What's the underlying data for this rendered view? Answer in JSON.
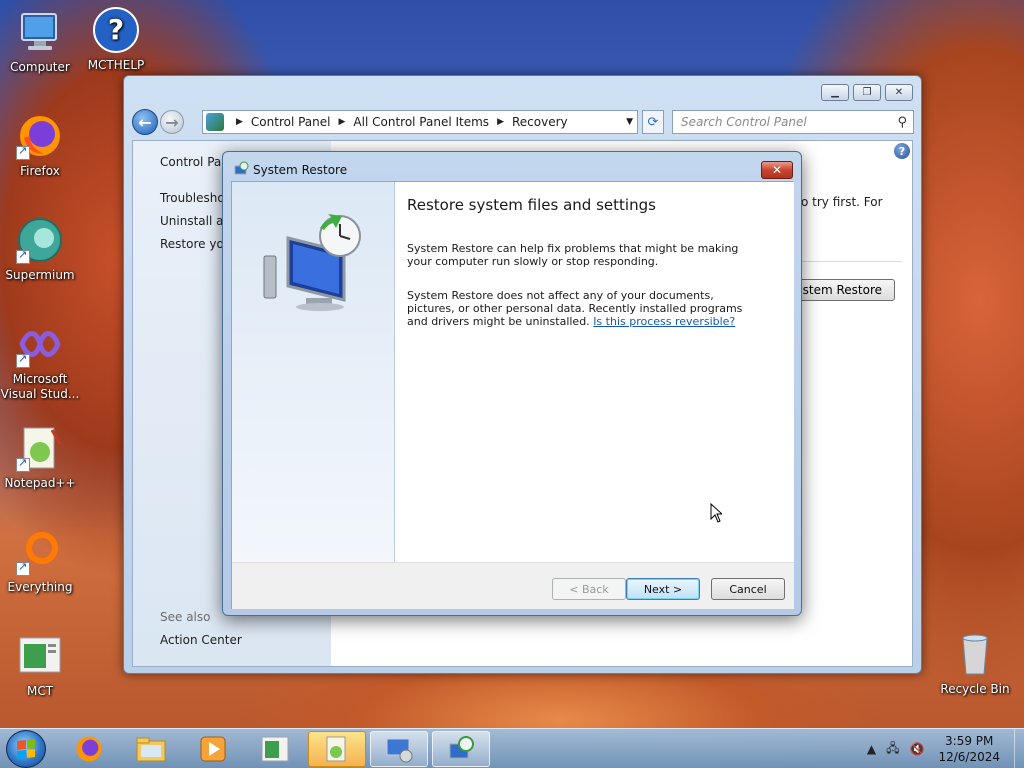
{
  "desktop": {
    "icons": [
      {
        "label": "Computer"
      },
      {
        "label": "MCTHELP"
      },
      {
        "label": "Firefox"
      },
      {
        "label": "Supermium"
      },
      {
        "label": "Microsoft Visual Stud..."
      },
      {
        "label": "Notepad++"
      },
      {
        "label": "Everything"
      },
      {
        "label": "MCT"
      },
      {
        "label": "Recycle Bin"
      }
    ]
  },
  "explorer": {
    "breadcrumb": [
      "Control Panel",
      "All Control Panel Items",
      "Recovery"
    ],
    "search_placeholder": "Search Control Panel",
    "left": {
      "home": "Control Panel Home",
      "links": [
        "Troubleshoot problems",
        "Uninstall a program",
        "Restore your computer to an earlier time"
      ],
      "see_also": "See also",
      "action_center": "Action Center"
    },
    "right_text": "o try first. For",
    "open_sr_button": "Open System Restore"
  },
  "dialog": {
    "title": "System Restore",
    "heading": "Restore system files and settings",
    "p1": "System Restore can help fix problems that might be making your computer run slowly or stop responding.",
    "p2": "System Restore does not affect any of your documents, pictures, or other personal data. Recently installed programs and drivers might be uninstalled.",
    "link": "Is this process reversible?",
    "buttons": {
      "back": "< Back",
      "next": "Next >",
      "cancel": "Cancel"
    }
  },
  "taskbar": {
    "time": "3:59 PM",
    "date": "12/6/2024"
  }
}
